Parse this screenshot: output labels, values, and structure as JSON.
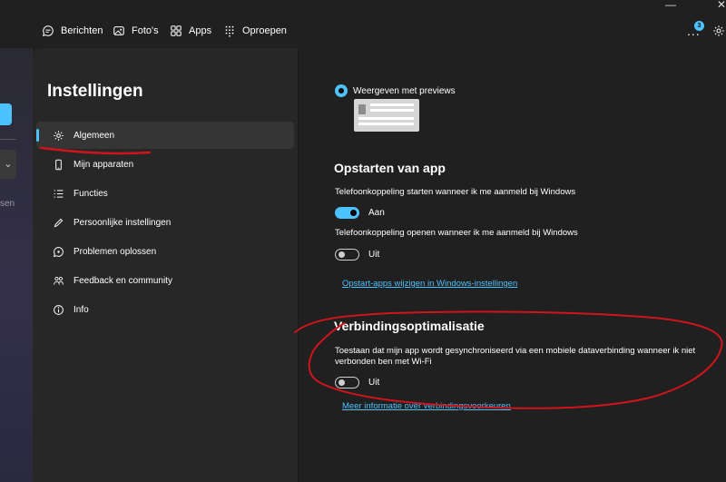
{
  "topnav": {
    "items": [
      {
        "label": "Berichten",
        "icon": "chat-icon"
      },
      {
        "label": "Foto's",
        "icon": "photo-icon"
      },
      {
        "label": "Apps",
        "icon": "apps-icon"
      },
      {
        "label": "Oproepen",
        "icon": "dialpad-icon"
      }
    ],
    "more_label": "...",
    "badge_count": "3"
  },
  "background_app": {
    "text": "sen"
  },
  "settings": {
    "title": "Instellingen",
    "menu": [
      {
        "label": "Algemeen",
        "icon": "gear-icon",
        "active": true
      },
      {
        "label": "Mijn apparaten",
        "icon": "phone-icon"
      },
      {
        "label": "Functies",
        "icon": "list-icon"
      },
      {
        "label": "Persoonlijke instellingen",
        "icon": "pen-icon"
      },
      {
        "label": "Problemen oplossen",
        "icon": "troubleshoot-icon"
      },
      {
        "label": "Feedback en community",
        "icon": "people-icon"
      },
      {
        "label": "Info",
        "icon": "info-icon"
      }
    ]
  },
  "content": {
    "preview_option": {
      "label": "Weergeven met previews",
      "selected": true
    },
    "startup": {
      "title": "Opstarten van app",
      "option1": {
        "description": "Telefoonkoppeling starten wanneer ik me aanmeld bij Windows",
        "state": "Aan",
        "on": true
      },
      "option2": {
        "description": "Telefoonkoppeling openen wanneer ik me aanmeld bij Windows",
        "state": "Uit",
        "on": false
      },
      "link": "Opstart-apps wijzigen in Windows-instellingen"
    },
    "connection": {
      "title": "Verbindingsoptimalisatie",
      "description": "Toestaan dat mijn app wordt gesynchroniseerd via een mobiele dataverbinding wanneer ik niet verbonden ben met Wi-Fi",
      "state": "Uit",
      "on": false,
      "link": "Meer informatie over verbindingsvoorkeuren"
    }
  },
  "colors": {
    "accent": "#4cc2ff",
    "annotation": "#d0141b",
    "background": "#202020"
  }
}
